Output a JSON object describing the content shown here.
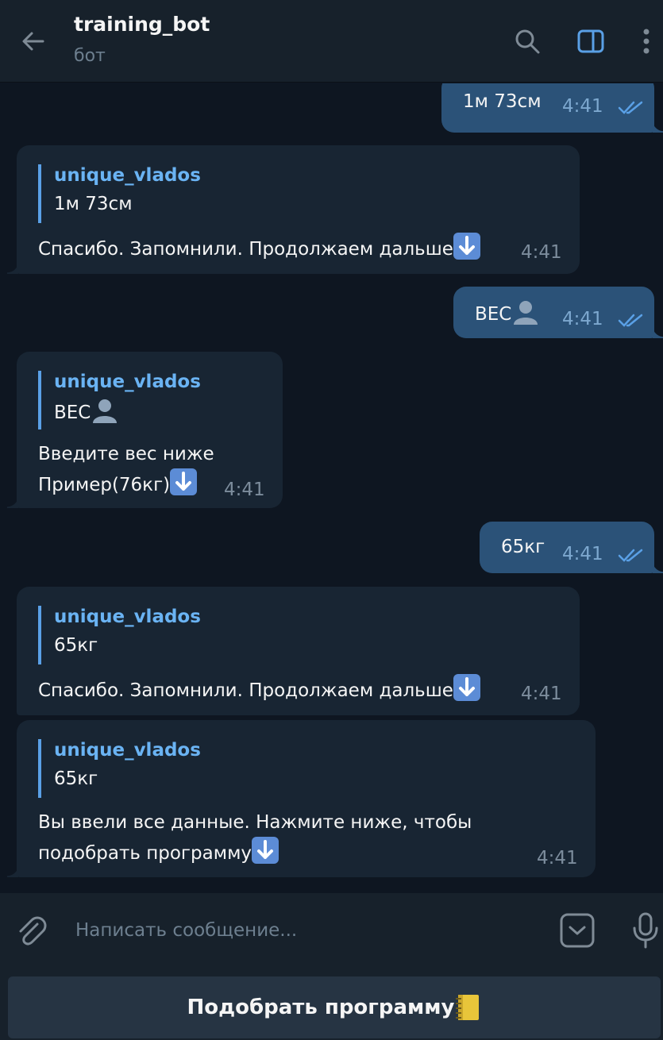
{
  "header": {
    "title": "training_bot",
    "subtitle": "бот"
  },
  "messages": {
    "m1": {
      "text": "1м 73см",
      "time": "4:41"
    },
    "m2": {
      "reply_name": "unique_vlados",
      "reply_text": "1м 73см",
      "text": "Спасибо. Запомнили. Продолжаем дальше",
      "time": "4:41"
    },
    "m3": {
      "text": "ВЕС",
      "time": "4:41"
    },
    "m4": {
      "reply_name": "unique_vlados",
      "reply_text": "ВЕС",
      "line1": "Введите вес ниже",
      "line2": "Пример(76кг)",
      "time": "4:41"
    },
    "m5": {
      "text": "65кг",
      "time": "4:41"
    },
    "m6": {
      "reply_name": "unique_vlados",
      "reply_text": "65кг",
      "text": "Спасибо. Запомнили. Продолжаем дальше",
      "time": "4:41"
    },
    "m7": {
      "reply_name": "unique_vlados",
      "reply_text": "65кг",
      "line1": "Вы ввели все данные. Нажмите ниже, чтобы",
      "line2": "подобрать программу",
      "time": "4:41"
    }
  },
  "composer": {
    "placeholder": "Написать сообщение..."
  },
  "keyboard": {
    "button_label": "Подобрать программу"
  },
  "icons": {
    "back": "back-arrow-icon",
    "search": "search-icon",
    "panel": "side-panel-icon",
    "more": "more-vertical-icon",
    "attach": "paperclip-icon",
    "keyboard": "bot-keyboard-icon",
    "mic": "microphone-icon"
  },
  "colors": {
    "background": "#0e1621",
    "header": "#17212b",
    "incoming_bubble": "#182533",
    "outgoing_bubble": "#2b5278",
    "accent": "#6ab3f3",
    "keyboard_button": "#263443"
  }
}
